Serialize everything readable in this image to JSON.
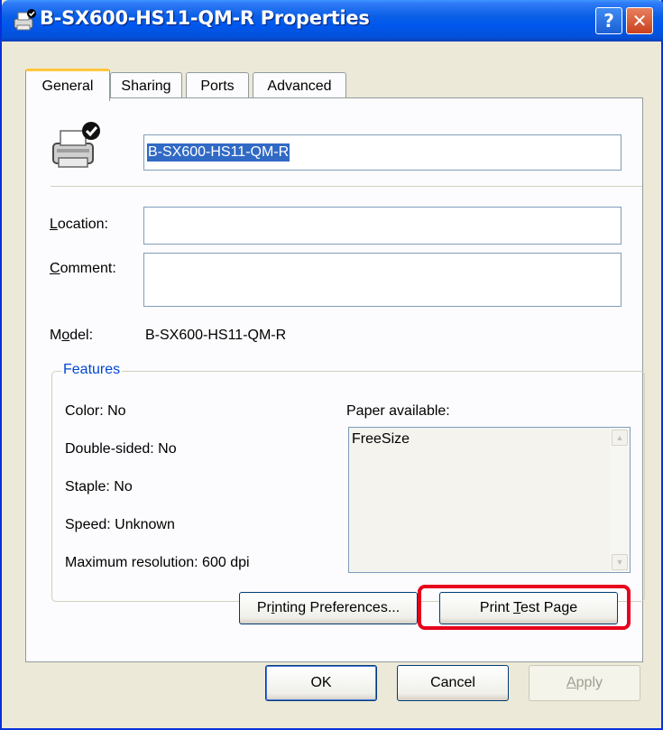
{
  "window": {
    "title": "B-SX600-HS11-QM-R Properties",
    "help_label": "?",
    "close_label": "✕"
  },
  "tabs": [
    {
      "label": "General",
      "active": true
    },
    {
      "label": "Sharing",
      "active": false
    },
    {
      "label": "Ports",
      "active": false
    },
    {
      "label": "Advanced",
      "active": false
    }
  ],
  "general": {
    "printer_name": "B-SX600-HS11-QM-R",
    "location_label": "Location:",
    "location_value": "",
    "comment_label": "Comment:",
    "comment_value": "",
    "model_label": "Model:",
    "model_value": "B-SX600-HS11-QM-R"
  },
  "features": {
    "title": "Features",
    "color": "Color: No",
    "double_sided": "Double-sided: No",
    "staple": "Staple: No",
    "speed": "Speed: Unknown",
    "max_resolution": "Maximum resolution: 600 dpi",
    "paper_label": "Paper available:",
    "paper_items": [
      "FreeSize"
    ]
  },
  "buttons": {
    "printing_preferences": "Printing Preferences...",
    "print_test_page": "Print Test Page",
    "ok": "OK",
    "cancel": "Cancel",
    "apply": "Apply"
  },
  "colors": {
    "titlebar": "#0058ee",
    "highlight": "#e8001c",
    "group_title": "#0046d5",
    "selection": "#316ac5"
  }
}
